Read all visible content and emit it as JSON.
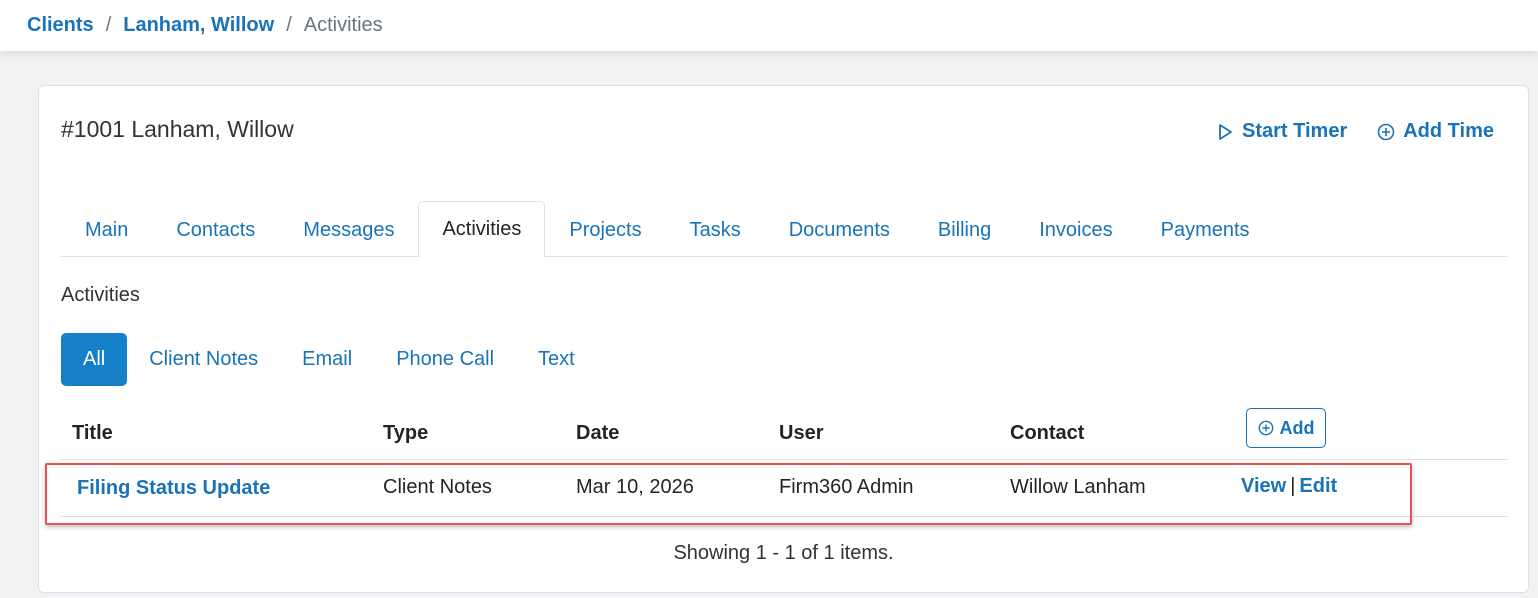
{
  "breadcrumb": {
    "items": [
      "Clients",
      "Lanham, Willow"
    ],
    "separator": "/",
    "current": "Activities"
  },
  "client": {
    "title": "#1001 Lanham, Willow"
  },
  "header_actions": {
    "start_timer": "Start Timer",
    "add_time": "Add Time"
  },
  "tabs": [
    {
      "label": "Main"
    },
    {
      "label": "Contacts"
    },
    {
      "label": "Messages"
    },
    {
      "label": "Activities",
      "active": true
    },
    {
      "label": "Projects"
    },
    {
      "label": "Tasks"
    },
    {
      "label": "Documents"
    },
    {
      "label": "Billing"
    },
    {
      "label": "Invoices"
    },
    {
      "label": "Payments"
    }
  ],
  "section": {
    "title": "Activities"
  },
  "filters": [
    {
      "label": "All",
      "active": true
    },
    {
      "label": "Client Notes"
    },
    {
      "label": "Email"
    },
    {
      "label": "Phone Call"
    },
    {
      "label": "Text"
    }
  ],
  "table": {
    "columns": [
      "Title",
      "Type",
      "Date",
      "User",
      "Contact"
    ],
    "add_label": "Add",
    "rows": [
      {
        "title": "Filing Status Update",
        "type": "Client Notes",
        "date": "Mar 10, 2026",
        "user": "Firm360 Admin",
        "contact": "Willow Lanham",
        "view": "View",
        "edit": "Edit",
        "separator": "|"
      }
    ],
    "pager": "Showing 1 - 1 of 1 items."
  },
  "colors": {
    "accent": "#1a73b8",
    "active_pill": "#1580c8",
    "highlight": "#e5535b"
  }
}
